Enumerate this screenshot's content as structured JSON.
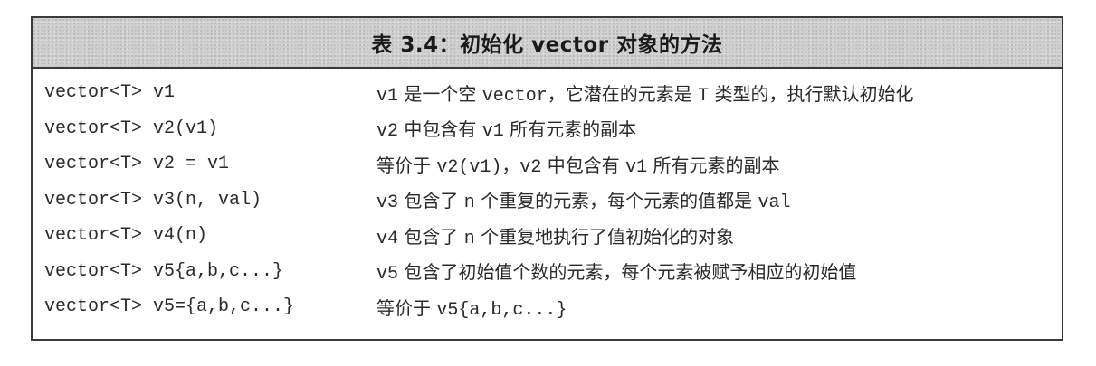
{
  "table": {
    "title": "表 3.4：初始化 vector 对象的方法",
    "rows": [
      {
        "code": "vector<T> v1",
        "desc": [
          {
            "text": "v1",
            "mono": true
          },
          {
            "text": " 是一个空 ",
            "mono": false
          },
          {
            "text": "vector",
            "mono": true
          },
          {
            "text": "，它潜在的元素是 ",
            "mono": false
          },
          {
            "text": "T",
            "mono": true
          },
          {
            "text": " 类型的，执行默认初始化",
            "mono": false
          }
        ]
      },
      {
        "code": "vector<T> v2(v1)",
        "desc": [
          {
            "text": "v2",
            "mono": true
          },
          {
            "text": " 中包含有 ",
            "mono": false
          },
          {
            "text": "v1",
            "mono": true
          },
          {
            "text": " 所有元素的副本",
            "mono": false
          }
        ]
      },
      {
        "code": "vector<T> v2 = v1",
        "desc": [
          {
            "text": "等价于 ",
            "mono": false
          },
          {
            "text": "v2(v1)",
            "mono": true
          },
          {
            "text": "，",
            "mono": false
          },
          {
            "text": "v2",
            "mono": true
          },
          {
            "text": " 中包含有 ",
            "mono": false
          },
          {
            "text": "v1",
            "mono": true
          },
          {
            "text": " 所有元素的副本",
            "mono": false
          }
        ]
      },
      {
        "code": "vector<T> v3(n, val)",
        "desc": [
          {
            "text": "v3",
            "mono": true
          },
          {
            "text": " 包含了 ",
            "mono": false
          },
          {
            "text": "n",
            "mono": true
          },
          {
            "text": " 个重复的元素，每个元素的值都是 ",
            "mono": false
          },
          {
            "text": "val",
            "mono": true
          }
        ]
      },
      {
        "code": "vector<T> v4(n)",
        "desc": [
          {
            "text": "v4",
            "mono": true
          },
          {
            "text": " 包含了 ",
            "mono": false
          },
          {
            "text": "n",
            "mono": true
          },
          {
            "text": " 个重复地执行了值初始化的对象",
            "mono": false
          }
        ]
      },
      {
        "code": "vector<T> v5{a,b,c...}",
        "desc": [
          {
            "text": "v5",
            "mono": true
          },
          {
            "text": " 包含了初始值个数的元素，每个元素被赋予相应的初始值",
            "mono": false
          }
        ]
      },
      {
        "code": "vector<T> v5={a,b,c...}",
        "desc": [
          {
            "text": "等价于 ",
            "mono": false
          },
          {
            "text": "v5{a,b,c...}",
            "mono": true
          }
        ]
      }
    ]
  }
}
